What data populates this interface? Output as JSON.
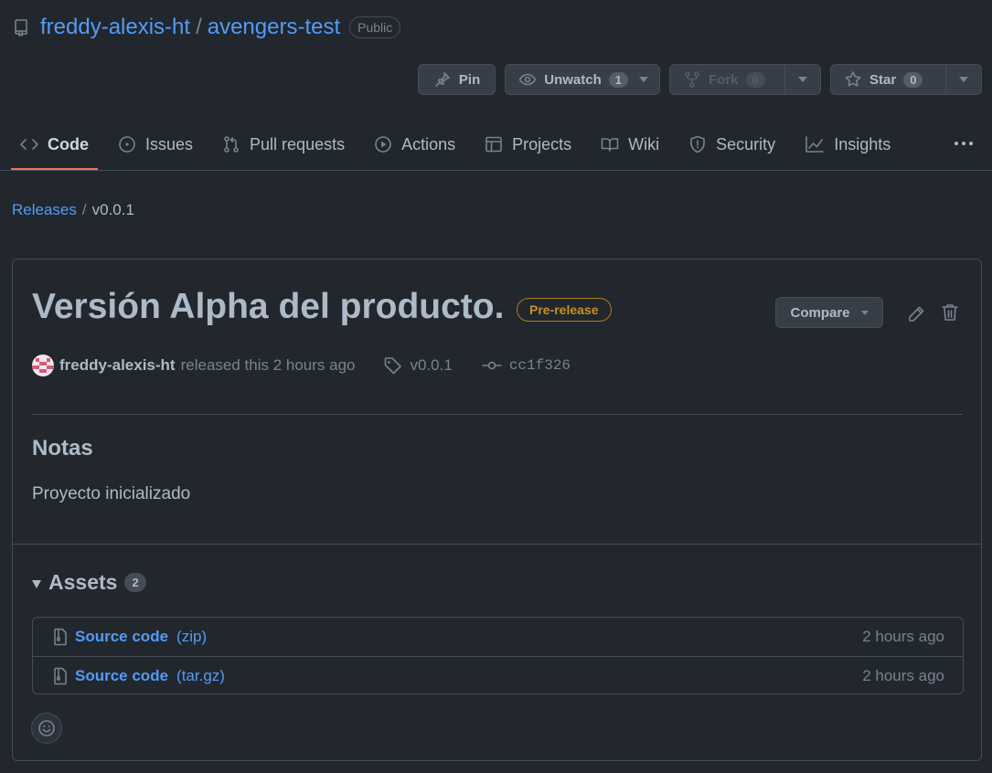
{
  "repo": {
    "owner": "freddy-alexis-ht",
    "separator": "/",
    "name": "avengers-test",
    "visibility": "Public"
  },
  "actions": {
    "pin": {
      "label": "Pin"
    },
    "unwatch": {
      "label": "Unwatch",
      "count": "1"
    },
    "fork": {
      "label": "Fork",
      "count": "0"
    },
    "star": {
      "label": "Star",
      "count": "0"
    }
  },
  "tabs": [
    {
      "label": "Code",
      "icon": "code-icon",
      "active": true
    },
    {
      "label": "Issues",
      "icon": "issue-icon"
    },
    {
      "label": "Pull requests",
      "icon": "pull-request-icon"
    },
    {
      "label": "Actions",
      "icon": "play-icon"
    },
    {
      "label": "Projects",
      "icon": "table-icon"
    },
    {
      "label": "Wiki",
      "icon": "book-icon"
    },
    {
      "label": "Security",
      "icon": "shield-icon"
    },
    {
      "label": "Insights",
      "icon": "graph-icon"
    }
  ],
  "breadcrumb": {
    "parent": "Releases",
    "separator": "/",
    "current": "v0.0.1"
  },
  "release": {
    "title": "Versión Alpha del producto.",
    "badge": "Pre-release",
    "compare_label": "Compare",
    "author": "freddy-alexis-ht",
    "released_text": "released this 2 hours ago",
    "tag": "v0.0.1",
    "commit": "cc1f326",
    "notes_heading": "Notas",
    "notes_body": "Proyecto inicializado"
  },
  "assets": {
    "heading": "Assets",
    "count": "2",
    "items": [
      {
        "name": "Source code",
        "ext": "(zip)",
        "time": "2 hours ago"
      },
      {
        "name": "Source code",
        "ext": "(tar.gz)",
        "time": "2 hours ago"
      }
    ]
  },
  "colors": {
    "bg": "#22272e",
    "link": "#539bf5",
    "accent_tab": "#ec775c",
    "prerelease": "#c69026"
  }
}
